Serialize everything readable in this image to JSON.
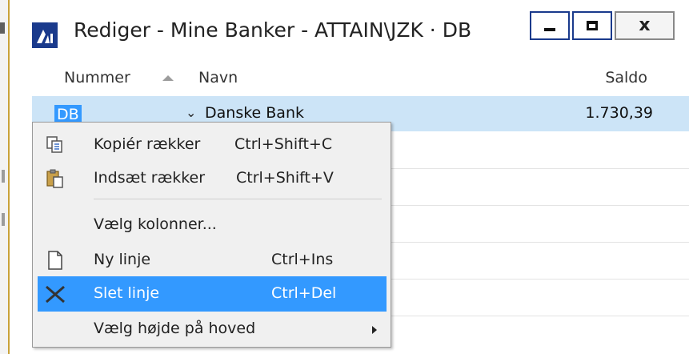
{
  "window": {
    "title": "Rediger - Mine Banker - ATTAIN\\JZK · DB",
    "app_icon": "dynamics-nav-logo",
    "controls": {
      "minimize": "minimize-icon",
      "maximize": "maximize-icon",
      "close": "close-icon"
    }
  },
  "grid": {
    "columns": [
      "Nummer",
      "Navn",
      "Saldo"
    ],
    "sort_column": "Nummer",
    "sort_direction": "ascending",
    "rows": [
      {
        "nummer": "DB",
        "navn": "Danske Bank",
        "saldo": "1.730,39"
      }
    ]
  },
  "context_menu": {
    "items": [
      {
        "label": "Kopiér rækker",
        "shortcut": "Ctrl+Shift+C",
        "icon": "copy-rows-icon"
      },
      {
        "label": "Indsæt rækker",
        "shortcut": "Ctrl+Shift+V",
        "icon": "paste-rows-icon"
      },
      {
        "label": "Vælg kolonner...",
        "shortcut": "",
        "icon": ""
      },
      {
        "label": "Ny linje",
        "shortcut": "Ctrl+Ins",
        "icon": "new-line-icon"
      },
      {
        "label": "Slet linje",
        "shortcut": "Ctrl+Del",
        "icon": "delete-icon"
      },
      {
        "label": "Vælg højde på hoved",
        "shortcut": "",
        "icon": ""
      }
    ],
    "highlighted": "Slet linje"
  },
  "colors": {
    "selection_row": "#cce4f7",
    "menu_highlight": "#3399ff",
    "title_icon": "#1a3a8c"
  }
}
